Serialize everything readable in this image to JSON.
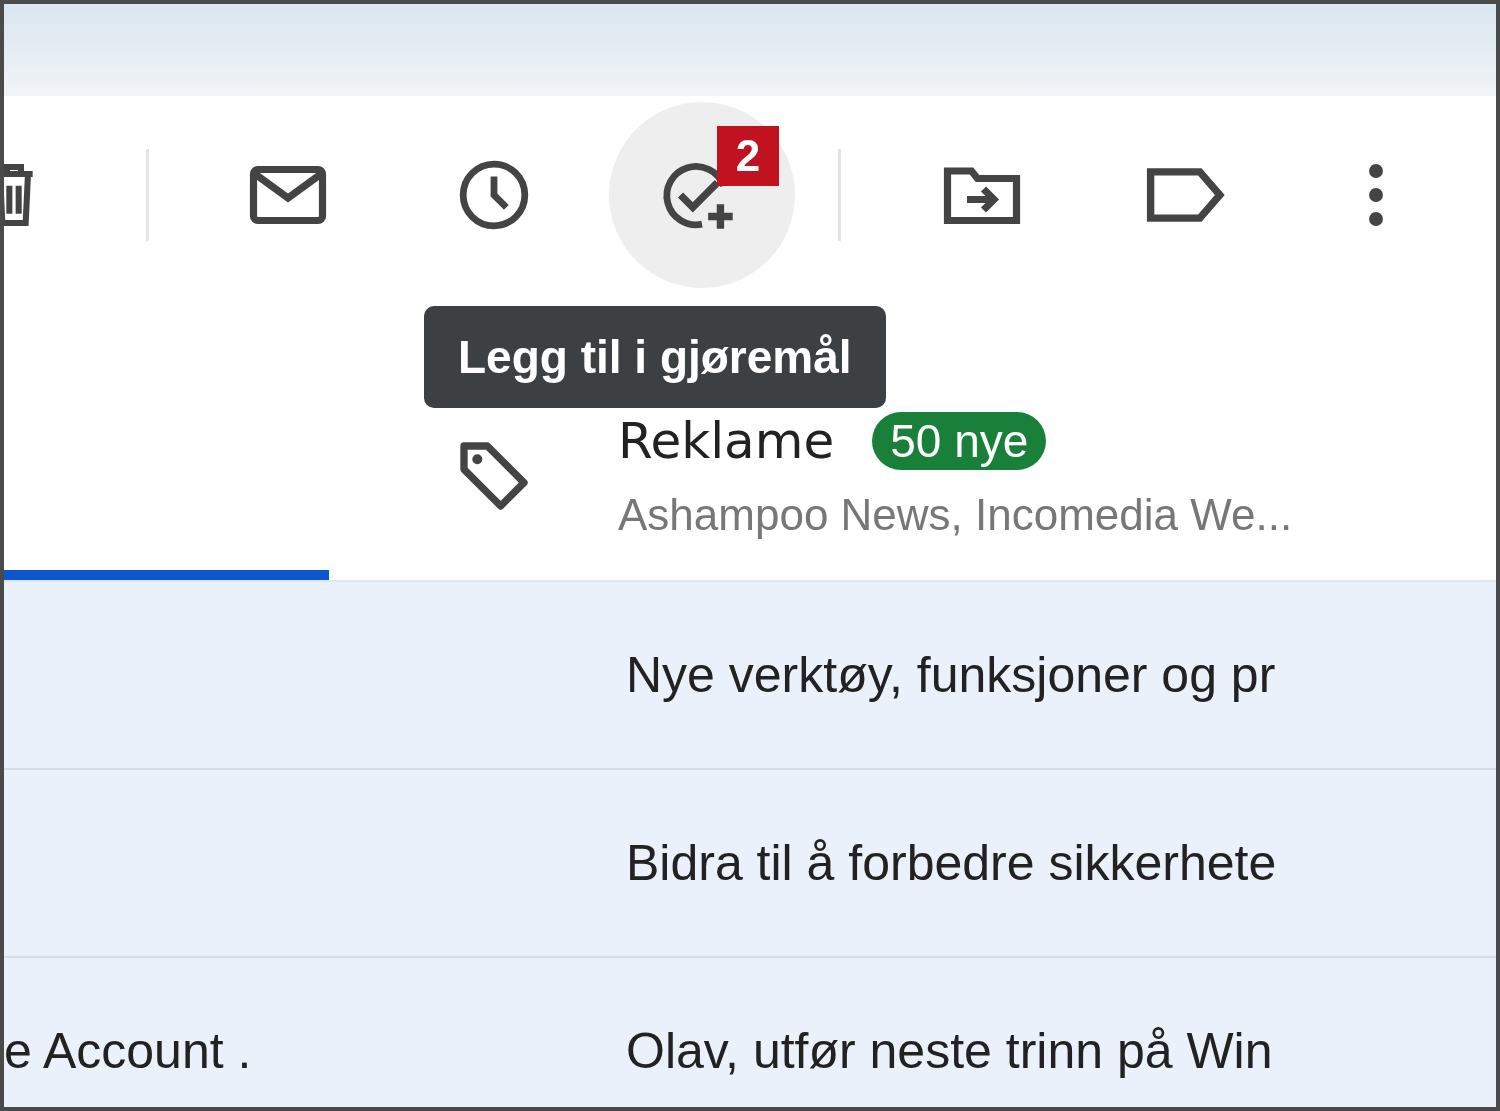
{
  "toolbar": {
    "buttons": [
      {
        "kind": "trash",
        "hovered": false
      },
      {
        "kind": "divider"
      },
      {
        "kind": "mail",
        "hovered": false
      },
      {
        "kind": "clock",
        "hovered": false
      },
      {
        "kind": "task",
        "hovered": true,
        "badge": "2"
      },
      {
        "kind": "divider"
      },
      {
        "kind": "move",
        "hovered": false
      },
      {
        "kind": "label",
        "hovered": false
      },
      {
        "kind": "more",
        "hovered": false
      }
    ],
    "tooltip": "Legg til i gjøremål"
  },
  "tabs": [
    {
      "selected": true
    },
    {
      "label": "Reklame",
      "badge": "50 nye",
      "senders": "Ashampoo News, Incomedia We...",
      "selected": false
    }
  ],
  "rows": [
    {
      "subject": "Nye verktøy, funksjoner og pr"
    },
    {
      "subject": "Bidra til å forbedre sikkerhete"
    },
    {
      "sender": "e Account .",
      "subject": "Olav, utfør neste trinn på Win"
    }
  ]
}
